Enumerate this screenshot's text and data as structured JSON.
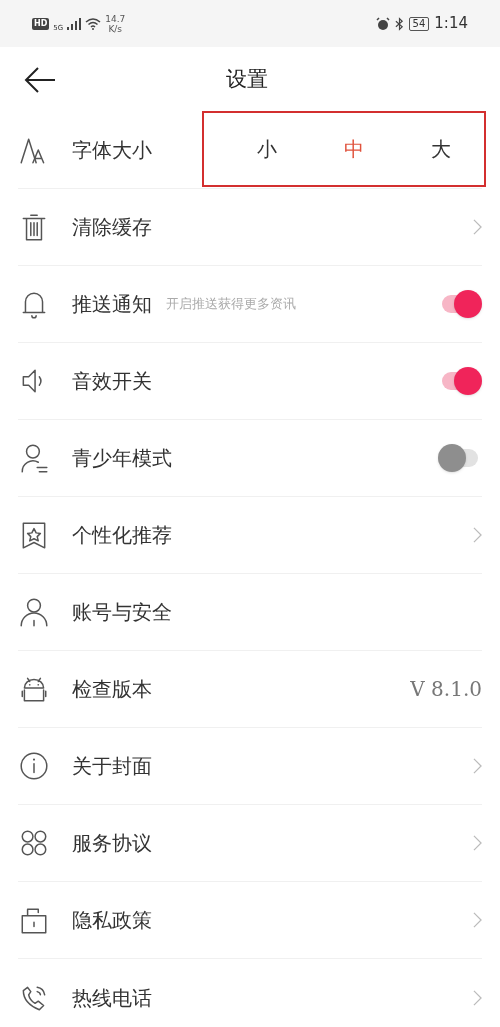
{
  "status_bar": {
    "hd": "HD",
    "network": "5G",
    "speed": "14.7",
    "speed_unit": "K/s",
    "battery": "54",
    "time": "1:14"
  },
  "header": {
    "title": "设置"
  },
  "rows": [
    {
      "kind": "font_size",
      "label": "字体大小",
      "options": [
        {
          "label": "小",
          "selected": false
        },
        {
          "label": "中",
          "selected": true
        },
        {
          "label": "大",
          "selected": false
        }
      ]
    },
    {
      "kind": "link",
      "label": "清除缓存"
    },
    {
      "kind": "toggle",
      "label": "推送通知",
      "hint": "开启推送获得更多资讯",
      "on": true
    },
    {
      "kind": "toggle",
      "label": "音效开关",
      "on": true
    },
    {
      "kind": "toggle",
      "label": "青少年模式",
      "on": false
    },
    {
      "kind": "link",
      "label": "个性化推荐"
    },
    {
      "kind": "plain",
      "label": "账号与安全"
    },
    {
      "kind": "value",
      "label": "检查版本",
      "value": "V 8.1.0"
    },
    {
      "kind": "link",
      "label": "关于封面"
    },
    {
      "kind": "link",
      "label": "服务协议"
    },
    {
      "kind": "link",
      "label": "隐私政策"
    },
    {
      "kind": "link",
      "label": "热线电话"
    }
  ]
}
